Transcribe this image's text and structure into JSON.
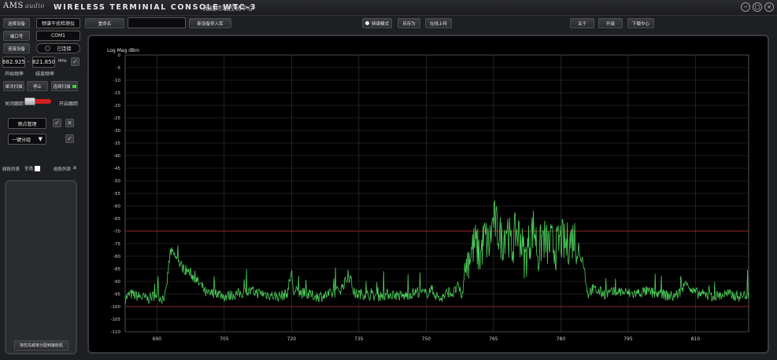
{
  "titlebar": {
    "logo": "AMS",
    "logo_sub": "audio",
    "title": "WIRELESS TERMINIAL CONSOLE WTC-3",
    "subtitle": "无线终端控制中心",
    "window_buttons": [
      "−",
      "□",
      "×"
    ]
  },
  "toolbar": {
    "select_device": "选择设备",
    "device_name": "频谱干扰检测仪",
    "rename": "重命名",
    "rename_value": "",
    "import_devices": "新设备导入库",
    "spectrum_mode": "频谱模式",
    "save_as": "另存为",
    "online_upload": "在线上传",
    "about": "关于",
    "upgrade": "升级",
    "download_center": "下载中心"
  },
  "left": {
    "port_label": "端口号",
    "port_value": "COM1",
    "connect_btn": "连接设备",
    "connected": "已连接",
    "start_freq": "682.925",
    "end_freq": "821.850",
    "freq_dash": "-",
    "unit": "MHz",
    "start_freq_label": "开始频率",
    "end_freq_label": "结束频率",
    "single_scan": "单次扫描",
    "stop": "停止",
    "continuous_scan": "连续扫描",
    "close_trace": "关闭跟踪",
    "open_trace": "开启跟踪",
    "save_mgmt": "频点管理",
    "one_key": "一键分组",
    "list_label": "频段列表",
    "select_all": "全选",
    "group_list": "组段列表",
    "write_btn": "将优先频率分配到接收机",
    "check_icon": "✓",
    "close_icon": "✕"
  },
  "chart_data": {
    "type": "line",
    "ylabel": "Log Mag dBm",
    "ylim": [
      -110,
      0
    ],
    "yticks": [
      0,
      -5,
      -10,
      -15,
      -20,
      -25,
      -30,
      -35,
      -40,
      -45,
      -50,
      -55,
      -60,
      -65,
      -70,
      -75,
      -80,
      -85,
      -90,
      -95,
      -100,
      -105,
      -110
    ],
    "xlim": [
      682.925,
      821.85
    ],
    "xticks": [
      690,
      705,
      720,
      735,
      750,
      765,
      780,
      795,
      810
    ],
    "reference_lines": [
      -70,
      -100
    ],
    "grid": true,
    "colors": {
      "trace": "#4cd05a",
      "reference": "#c0262d",
      "grid": "#3a3a3a"
    },
    "series": [
      {
        "x": [
          682.9,
          684,
          686,
          688,
          689,
          690,
          691,
          692,
          692.5,
          693,
          694,
          695,
          696,
          697,
          698,
          699,
          700,
          701,
          702,
          703,
          705,
          708,
          711,
          714,
          717,
          719,
          720,
          720.5,
          721,
          723,
          726,
          729,
          731,
          732,
          733,
          734,
          736,
          739,
          742,
          745,
          748,
          750,
          751,
          752,
          753,
          754,
          755,
          756,
          757,
          758,
          759,
          760,
          761,
          762,
          763,
          764,
          765,
          766,
          767,
          768,
          769,
          770,
          771,
          772,
          773,
          774,
          775,
          776,
          777,
          778,
          779,
          780,
          781,
          782,
          783,
          784,
          785,
          786,
          787,
          790,
          793,
          796,
          799,
          802,
          805,
          807,
          808,
          809,
          811,
          814,
          817,
          820,
          821.8
        ],
        "y": [
          -97,
          -95,
          -96,
          -97,
          -96,
          -95,
          -97,
          -95,
          -86,
          -78,
          -80,
          -83,
          -85,
          -86,
          -88,
          -90,
          -92,
          -95,
          -95,
          -94,
          -96,
          -95,
          -94,
          -95,
          -96,
          -95,
          -86,
          -95,
          -94,
          -95,
          -96,
          -95,
          -93,
          -90,
          -88,
          -95,
          -95,
          -96,
          -95,
          -96,
          -94,
          -95,
          -93,
          -95,
          -97,
          -96,
          -94,
          -95,
          -92,
          -96,
          -82,
          -78,
          -75,
          -80,
          -72,
          -76,
          -65,
          -70,
          -74,
          -67,
          -78,
          -70,
          -72,
          -82,
          -74,
          -68,
          -80,
          -72,
          -76,
          -75,
          -77,
          -73,
          -76,
          -74,
          -72,
          -78,
          -82,
          -95,
          -93,
          -95,
          -94,
          -95,
          -94,
          -95,
          -96,
          -94,
          -89,
          -94,
          -95,
          -96,
          -95,
          -96,
          -95
        ]
      }
    ]
  }
}
